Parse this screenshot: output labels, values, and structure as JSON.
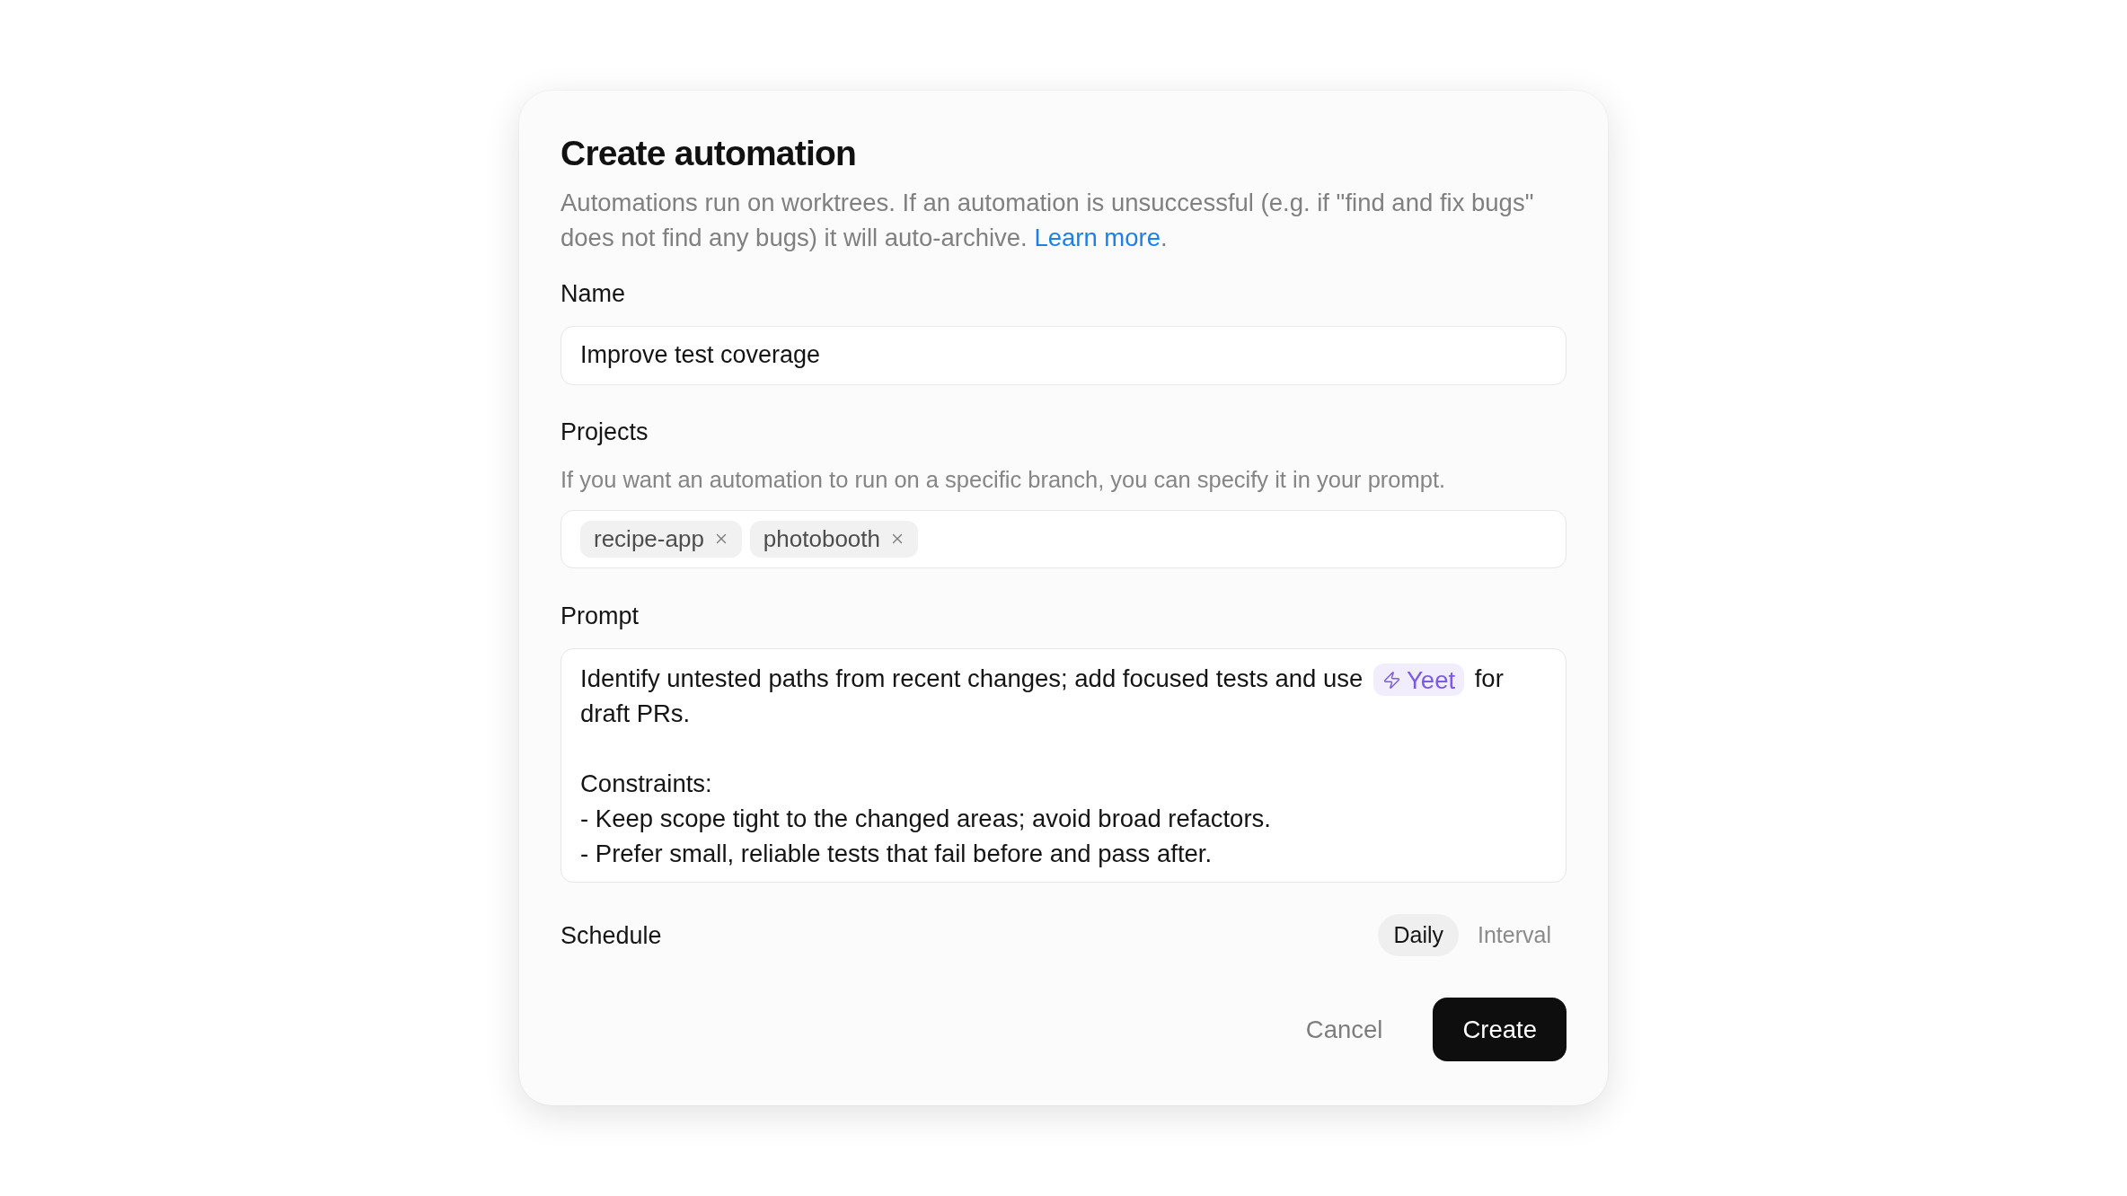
{
  "dialog": {
    "title": "Create automation",
    "description": [
      {
        "kind": "text",
        "text": "Automations run on worktrees. If an automation is unsuccessful (e.g. if \"find and fix bugs\" does not find any bugs) it will auto-archive. "
      },
      {
        "kind": "link",
        "text": "Learn more"
      },
      {
        "kind": "text",
        "text": "."
      }
    ],
    "name": {
      "label": "Name",
      "value": "Improve test coverage"
    },
    "projects": {
      "label": "Projects",
      "hint": "If you want an automation to run on a specific branch, you can specify it in your prompt.",
      "tags": [
        {
          "label": "recipe-app"
        },
        {
          "label": "photobooth"
        }
      ]
    },
    "prompt": {
      "label": "Prompt",
      "intro": [
        {
          "kind": "text",
          "text": "Identify untested paths from recent changes; add focused tests and use"
        },
        {
          "kind": "mention",
          "text": "Yeet"
        },
        {
          "kind": "text",
          "text": "for draft PRs."
        }
      ],
      "lines": [
        "Constraints:",
        "- Keep scope tight to the changed areas; avoid broad refactors.",
        "- Prefer small, reliable tests that fail before and pass after."
      ]
    },
    "schedule": {
      "label": "Schedule",
      "options": [
        {
          "label": "Daily",
          "selected": true
        },
        {
          "label": "Interval",
          "selected": false
        }
      ]
    },
    "actions": [
      {
        "label": "Cancel",
        "kind": "cancel"
      },
      {
        "label": "Create",
        "kind": "submit"
      }
    ]
  }
}
